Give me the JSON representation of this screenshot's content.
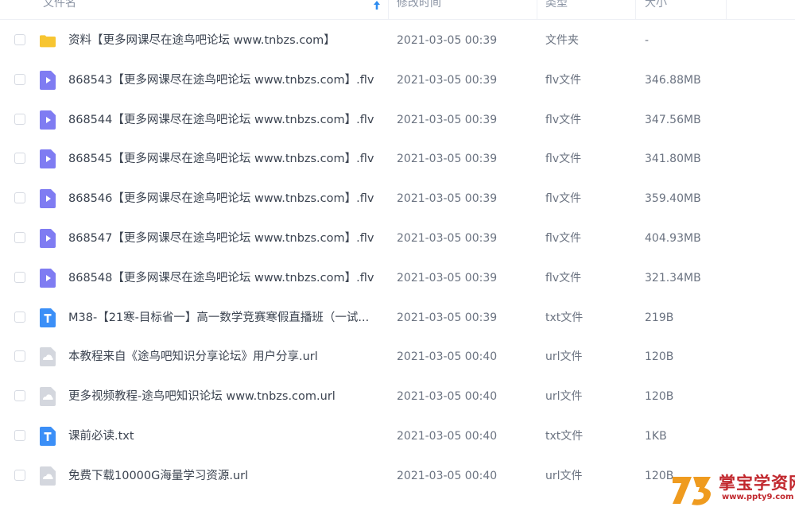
{
  "table_header": {
    "name_label": "文件名",
    "modified_label": "修改时间",
    "type_label": "类型",
    "size_label": "大小"
  },
  "files": [
    {
      "icon": "folder-icon",
      "name": "资料【更多网课尽在途鸟吧论坛 www.tnbzs.com】",
      "modified": "2021-03-05 00:39",
      "type": "文件夹",
      "size": "-"
    },
    {
      "icon": "video-file-icon",
      "name": "868543【更多网课尽在途鸟吧论坛 www.tnbzs.com】.flv",
      "modified": "2021-03-05 00:39",
      "type": "flv文件",
      "size": "346.88MB"
    },
    {
      "icon": "video-file-icon",
      "name": "868544【更多网课尽在途鸟吧论坛 www.tnbzs.com】.flv",
      "modified": "2021-03-05 00:39",
      "type": "flv文件",
      "size": "347.56MB"
    },
    {
      "icon": "video-file-icon",
      "name": "868545【更多网课尽在途鸟吧论坛 www.tnbzs.com】.flv",
      "modified": "2021-03-05 00:39",
      "type": "flv文件",
      "size": "341.80MB"
    },
    {
      "icon": "video-file-icon",
      "name": "868546【更多网课尽在途鸟吧论坛 www.tnbzs.com】.flv",
      "modified": "2021-03-05 00:39",
      "type": "flv文件",
      "size": "359.40MB"
    },
    {
      "icon": "video-file-icon",
      "name": "868547【更多网课尽在途鸟吧论坛 www.tnbzs.com】.flv",
      "modified": "2021-03-05 00:39",
      "type": "flv文件",
      "size": "404.93MB"
    },
    {
      "icon": "video-file-icon",
      "name": "868548【更多网课尽在途鸟吧论坛 www.tnbzs.com】.flv",
      "modified": "2021-03-05 00:39",
      "type": "flv文件",
      "size": "321.34MB"
    },
    {
      "icon": "text-file-icon",
      "name": "M38-【21寒-目标省一】高一数学竞赛寒假直播班（一试...",
      "modified": "2021-03-05 00:39",
      "type": "txt文件",
      "size": "219B"
    },
    {
      "icon": "link-file-icon",
      "name": "本教程来自《途鸟吧知识分享论坛》用户分享.url",
      "modified": "2021-03-05 00:40",
      "type": "url文件",
      "size": "120B"
    },
    {
      "icon": "link-file-icon",
      "name": "更多视频教程-途鸟吧知识论坛 www.tnbzs.com.url",
      "modified": "2021-03-05 00:40",
      "type": "url文件",
      "size": "120B"
    },
    {
      "icon": "text-file-icon",
      "name": "课前必读.txt",
      "modified": "2021-03-05 00:40",
      "type": "txt文件",
      "size": "1KB"
    },
    {
      "icon": "link-file-icon",
      "name": "免费下载10000G海量学习资源.url",
      "modified": "2021-03-05 00:40",
      "type": "url文件",
      "size": "120B"
    }
  ],
  "watermark": {
    "title": "掌宝学资网",
    "url": "www.ppty9.com"
  },
  "colors": {
    "folder": "#f7c531",
    "video": "#7f7cf2",
    "text": "#3b8ff7",
    "link": "#d4d7de",
    "watermark": "#c1272d"
  }
}
